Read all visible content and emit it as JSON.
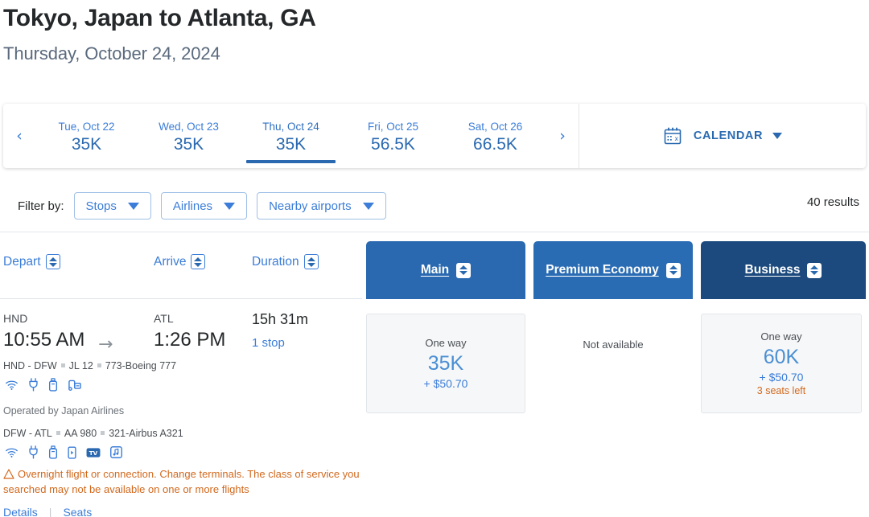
{
  "header": {
    "route_title": "Tokyo, Japan to Atlanta, GA",
    "date_subtitle": "Thursday, October 24, 2024"
  },
  "date_strip": {
    "prev_arrow": "‹",
    "next_arrow": "›",
    "dates": [
      {
        "label": "Tue, Oct 22",
        "price": "35K",
        "selected": false
      },
      {
        "label": "Wed, Oct 23",
        "price": "35K",
        "selected": false
      },
      {
        "label": "Thu, Oct 24",
        "price": "35K",
        "selected": true
      },
      {
        "label": "Fri, Oct 25",
        "price": "56.5K",
        "selected": false
      },
      {
        "label": "Sat, Oct 26",
        "price": "66.5K",
        "selected": false
      }
    ],
    "calendar_icon": "calendar-icon",
    "calendar_label": "CALENDAR"
  },
  "filters": {
    "label": "Filter by:",
    "chips": [
      {
        "label": "Stops"
      },
      {
        "label": "Airlines"
      },
      {
        "label": "Nearby airports"
      }
    ],
    "results": "40 results"
  },
  "columns": [
    {
      "label": "Depart"
    },
    {
      "label": "Arrive"
    },
    {
      "label": "Duration"
    }
  ],
  "cabins": [
    {
      "label": "Main",
      "bg": "#2a69b0"
    },
    {
      "label": "Premium Economy",
      "bg": "#2a6cb4"
    },
    {
      "label": "Business",
      "bg": "#1c4a7e"
    }
  ],
  "flight": {
    "depart_airport": "HND",
    "depart_time": "10:55 AM",
    "arrow": "→",
    "arrive_airport": "ATL",
    "arrive_time": "1:26 PM",
    "duration": "15h 31m",
    "stops": "1 stop",
    "legs": [
      {
        "route": "HND - DFW",
        "flight_number": "JL 12",
        "aircraft": "773-Boeing 777",
        "amenities": [
          "wifi-icon",
          "power-icon",
          "usb-icon",
          "entertainment-icon"
        ]
      },
      {
        "route": "DFW - ATL",
        "flight_number": "AA 980",
        "aircraft": "321-Airbus A321",
        "amenities": [
          "wifi-icon",
          "power-icon",
          "usb-icon",
          "device-icon",
          "tv-icon",
          "music-icon"
        ]
      }
    ],
    "operated_by": "Operated by Japan Airlines",
    "warning": "Overnight flight or connection. Change terminals. The class of service you searched may not be available on one or more flights",
    "details_link": "Details",
    "seats_link": "Seats",
    "link_separator": "|"
  },
  "fares": {
    "main": {
      "one_way": "One way",
      "miles": "35K",
      "cash": "+ $50.70",
      "seats_left": ""
    },
    "premium_economy": {
      "not_available": "Not available"
    },
    "business": {
      "one_way": "One way",
      "miles": "60K",
      "cash": "+ $50.70",
      "seats_left": "3 seats left"
    }
  },
  "colors": {
    "primary_blue": "#2a69b0",
    "link_blue": "#3b7dd8",
    "dark_navy": "#1c4a7e",
    "warning_orange": "#d2691e",
    "text_dark": "#25282a"
  }
}
